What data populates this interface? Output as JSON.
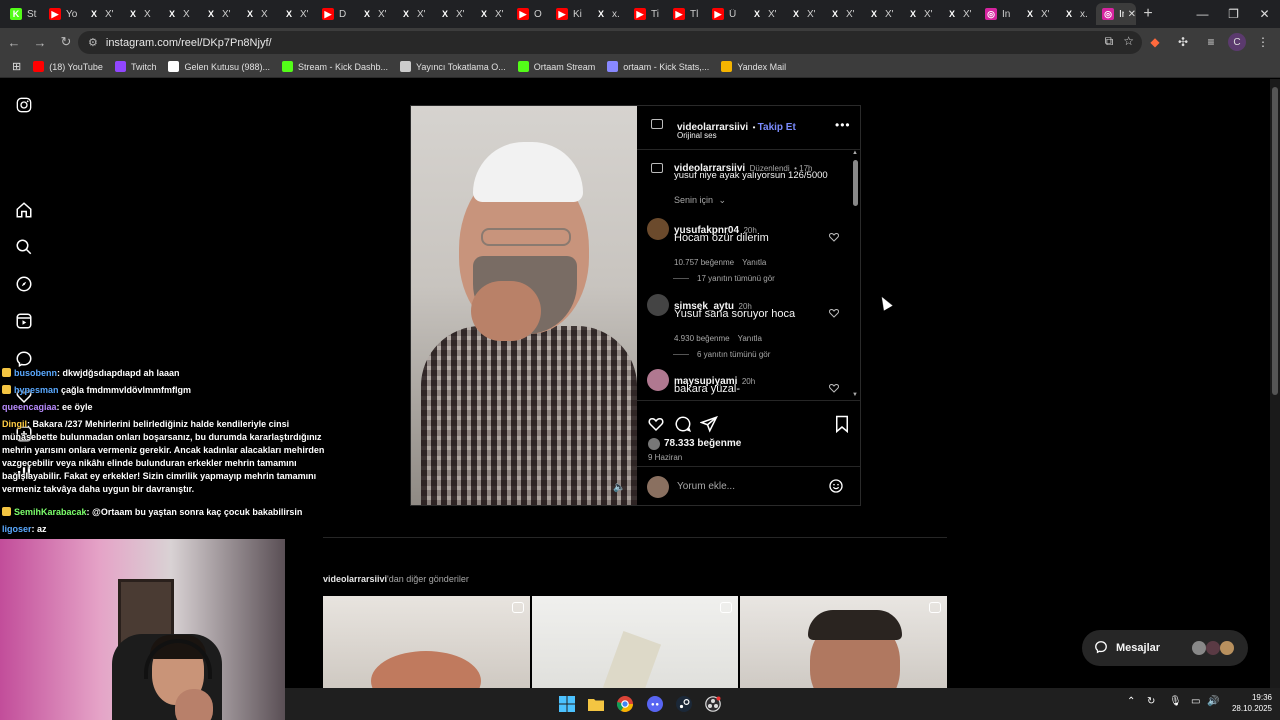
{
  "browser": {
    "tabs": [
      {
        "label": "St",
        "favicon": "K",
        "color": "#53fc18"
      },
      {
        "label": "Yo",
        "favicon": "▶",
        "color": "#ff0000"
      },
      {
        "label": "X'",
        "favicon": "X",
        "color": "#202124"
      },
      {
        "label": "X",
        "favicon": "X",
        "color": "#202124"
      },
      {
        "label": "X",
        "favicon": "X",
        "color": "#202124"
      },
      {
        "label": "X'",
        "favicon": "X",
        "color": "#202124"
      },
      {
        "label": "X",
        "favicon": "X",
        "color": "#202124"
      },
      {
        "label": "X'",
        "favicon": "X",
        "color": "#202124"
      },
      {
        "label": "D",
        "favicon": "▶",
        "color": "#ff0000"
      },
      {
        "label": "X'",
        "favicon": "X",
        "color": "#202124"
      },
      {
        "label": "X'",
        "favicon": "X",
        "color": "#202124"
      },
      {
        "label": "X'",
        "favicon": "X",
        "color": "#202124"
      },
      {
        "label": "X'",
        "favicon": "X",
        "color": "#202124"
      },
      {
        "label": "O",
        "favicon": "▶",
        "color": "#ff0000"
      },
      {
        "label": "Ki",
        "favicon": "▶",
        "color": "#ff0000"
      },
      {
        "label": "x.",
        "favicon": "X",
        "color": "#202124"
      },
      {
        "label": "Ti",
        "favicon": "▶",
        "color": "#ff0000"
      },
      {
        "label": "Tl",
        "favicon": "▶",
        "color": "#ff0000"
      },
      {
        "label": "Ü",
        "favicon": "▶",
        "color": "#ff0000"
      },
      {
        "label": "X'",
        "favicon": "X",
        "color": "#202124"
      },
      {
        "label": "X'",
        "favicon": "X",
        "color": "#202124"
      },
      {
        "label": "X'",
        "favicon": "X",
        "color": "#202124"
      },
      {
        "label": "X'",
        "favicon": "X",
        "color": "#202124"
      },
      {
        "label": "X'",
        "favicon": "X",
        "color": "#202124"
      },
      {
        "label": "X'",
        "favicon": "X",
        "color": "#202124"
      },
      {
        "label": "In",
        "favicon": "◎",
        "color": "#d6249f"
      },
      {
        "label": "X'",
        "favicon": "X",
        "color": "#202124"
      },
      {
        "label": "x.",
        "favicon": "X",
        "color": "#202124"
      }
    ],
    "active_tab": {
      "label": "In",
      "favicon": "◎",
      "color": "#d6249f"
    },
    "url": "instagram.com/reel/DKp7Pn8Njyf/",
    "bookmarks": [
      {
        "label": "(18) YouTube",
        "color": "#ff0000"
      },
      {
        "label": "Twitch",
        "color": "#9146ff"
      },
      {
        "label": "Gelen Kutusu (988)...",
        "color": "#ffffff"
      },
      {
        "label": "Stream - Kick Dashb...",
        "color": "#53fc18"
      },
      {
        "label": "Yayıncı Tokatlama O...",
        "color": "#cccccc"
      },
      {
        "label": "Ortaam Stream",
        "color": "#53fc18"
      },
      {
        "label": "ortaam - Kick Stats,...",
        "color": "#8888ff"
      },
      {
        "label": "Yandex Mail",
        "color": "#f5b400"
      }
    ],
    "profile_initial": "C"
  },
  "post": {
    "owner": "videolarrarsiivi",
    "follow_label": "Takip Et",
    "audio": "Orijinal ses",
    "caption_user": "videolarrarsiivi",
    "edited": "Düzenlendi",
    "caption_time": "17h",
    "caption": "yusuf niye ayak yalıyorsun 126/5000",
    "sort_label": "Senin için",
    "comments": [
      {
        "user": "yusufakpnr04",
        "time": "20h",
        "text": "Hocam özür dilerim",
        "likes": "10.757 beğenme",
        "reply": "Yanıtla",
        "view_replies": "17 yanıtın tümünü gör",
        "avatar_color": "#6b4a2c"
      },
      {
        "user": "simsek_aytu",
        "time": "20h",
        "text": "Yusuf sana soruyor hoca",
        "likes": "4.930 beğenme",
        "reply": "Yanıtla",
        "view_replies": "6 yanıtın tümünü gör",
        "avatar_color": "#444444"
      },
      {
        "user": "maysupiyami",
        "time": "20h",
        "text": "bakara yüzal-",
        "avatar_color": "#b07890"
      }
    ],
    "total_likes": "78.333 beğenme",
    "date": "9 Haziran",
    "add_comment_placeholder": "Yorum ekle..."
  },
  "more_posts": {
    "user": "videolarrarsiivi",
    "suffix": "'dan diğer gönderiler"
  },
  "messages_label": "Mesajlar",
  "chat": [
    {
      "user": "busobenn",
      "msg": ": dkwjdğsdıapdıapd ah laaan",
      "color": "#5aa9ff"
    },
    {
      "user": "hypesman",
      "msg": " çağla fmdmmvldövlmmfmflgm",
      "color": "#5aa9ff"
    },
    {
      "user": "queencagiaa",
      "msg": ": ee öyle",
      "color": "#b98cff"
    },
    {
      "user": "Dingil",
      "msg": ": Bakara /237 Mehirlerini belirlediğiniz halde kendileriyle cinsi münasebette bulunmadan onları boşarsanız, bu durumda kararlaştırdığınız mehrin yarısını onlara vermeniz gerekir. Ancak kadınlar alacakları mehirden vazgeçebilir veya nikâhı elinde bulunduran erkekler mehrin tamamını bağışlayabilir. Fakat ey erkekler! Sizin cimrilik yapmayıp mehrin tamamını vermeniz takvâya daha uygun bir davranıştır.",
      "color": "#ffcc44"
    },
    {
      "user": "SemihKarabacak",
      "msg": ": @Ortaam bu yaştan sonra kaç çocuk bakabilirsin",
      "color": "#7cff6b"
    },
    {
      "user": "ligoser",
      "msg": ": az",
      "color": "#5aa9ff"
    }
  ],
  "taskbar": {
    "time": "19:36",
    "date": "28.10.2025"
  }
}
